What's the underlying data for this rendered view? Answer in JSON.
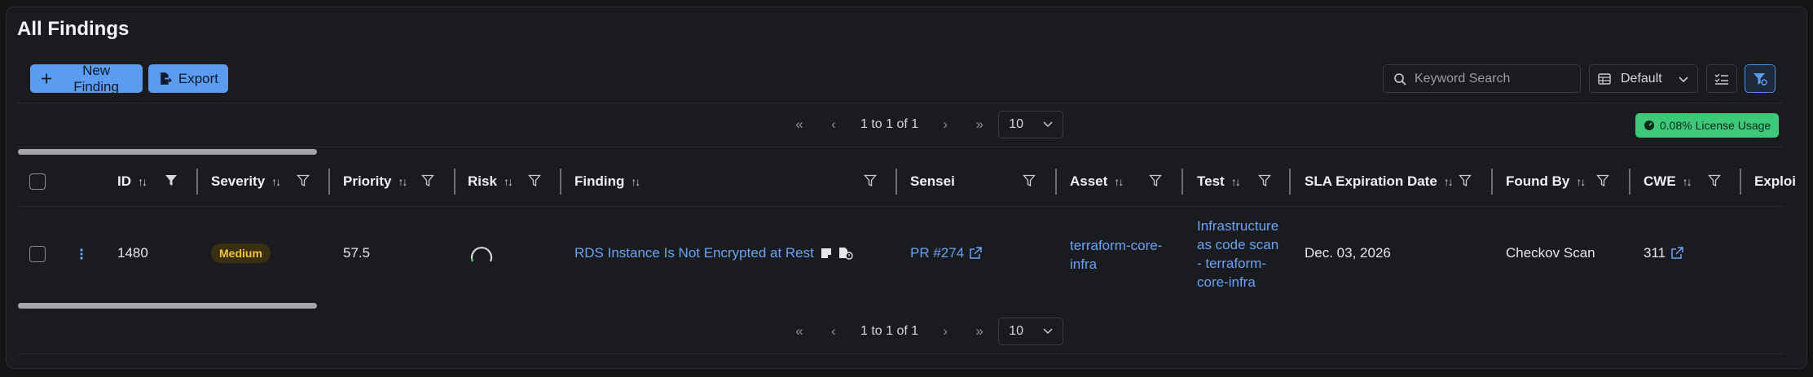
{
  "page": {
    "title": "All Findings"
  },
  "toolbar": {
    "new_finding_label": "New Finding",
    "export_label": "Export",
    "search_placeholder": "Keyword Search",
    "view_label": "Default"
  },
  "pager_top": {
    "info": "1 to 1 of 1",
    "page_size": "10"
  },
  "pager_bottom": {
    "info": "1 to 1 of 1",
    "page_size": "10"
  },
  "license_usage": "0.08% License Usage",
  "columns": {
    "id": "ID",
    "severity": "Severity",
    "priority": "Priority",
    "risk": "Risk",
    "finding": "Finding",
    "sensei": "Sensei",
    "asset": "Asset",
    "test": "Test",
    "sla": "SLA Expiration Date",
    "found_by": "Found By",
    "cwe": "CWE",
    "exploit": "Exploi"
  },
  "row": {
    "id": "1480",
    "severity": "Medium",
    "priority": "57.5",
    "finding": "RDS Instance Is Not Encrypted at Rest",
    "sensei": "PR #274",
    "asset_line1": "terraform-core-",
    "asset_line2": "infra",
    "test_line1": "Infrastructure",
    "test_line2": "as code scan",
    "test_line3": "- terraform-",
    "test_line4": "core-infra",
    "sla": "Dec. 03, 2026",
    "found_by": "Checkov Scan",
    "cwe": "311"
  },
  "colors": {
    "accent": "#5b9cf0",
    "link": "#6aa3f5",
    "license": "#3ec97a",
    "medium": "#f0c443"
  }
}
